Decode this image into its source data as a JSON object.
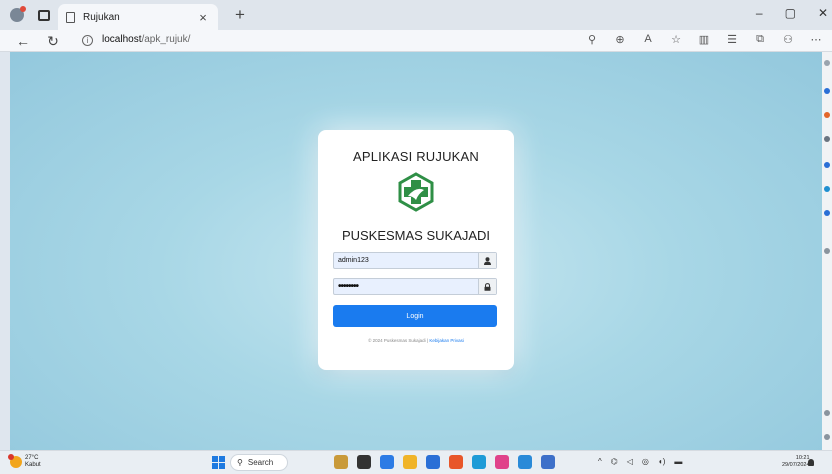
{
  "browser": {
    "tab_title": "Rujukan",
    "tab_close": "×",
    "new_tab": "+",
    "window_controls": [
      "–",
      "▢",
      "✕"
    ],
    "url_host": "localhost",
    "url_path": "/apk_rujuk/"
  },
  "login": {
    "app_title": "APLIKASI RUJUKAN",
    "org_name": "PUSKESMAS SUKAJADI",
    "username_value": "admin123",
    "password_masked": "••••••••",
    "login_label": "Login",
    "footer_text": "© 2024 Puskesmas Sukajadi |",
    "footer_link": "Kebijakan Privasi"
  },
  "taskbar": {
    "weather_temp": "27°C",
    "weather_desc": "Kabut",
    "search_label": "Search",
    "time": "10:21",
    "date": "29/07/2024"
  },
  "colors": {
    "accent": "#1a7bef",
    "logo_green": "#2f8f46",
    "background": "#a8d7e6"
  }
}
